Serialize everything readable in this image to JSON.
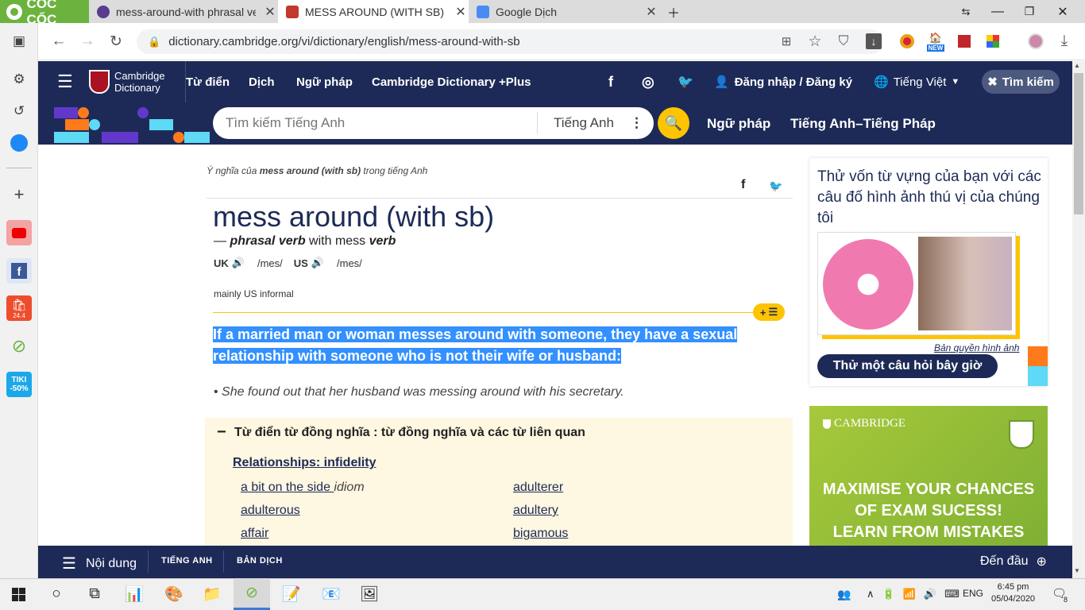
{
  "browser": {
    "name": "CỐC CỐC",
    "tabs": [
      {
        "title": "mess-around-with phrasal ve"
      },
      {
        "title": "MESS AROUND (WITH SB) | Đ"
      },
      {
        "title": "Google Dịch"
      }
    ],
    "url": "dictionary.cambridge.org/vi/dictionary/english/mess-around-with-sb",
    "badge_new": "NEW"
  },
  "sidebar": {
    "tiki_label": "TIKI",
    "tiki_discount": "-50%",
    "shopee_date": "24.4"
  },
  "site": {
    "logo_line1": "Cambridge",
    "logo_line2": "Dictionary",
    "nav": [
      "Từ điển",
      "Dịch",
      "Ngữ pháp",
      "Cambridge Dictionary +Plus"
    ],
    "login": "Đăng nhập / Đăng ký",
    "language": "Tiếng Việt",
    "search_button": "Tìm kiếm",
    "search_placeholder": "Tìm kiếm Tiếng Anh",
    "search_lang": "Tiếng Anh",
    "subnav": [
      "Ngữ pháp",
      "Tiếng Anh–Tiếng Pháp"
    ]
  },
  "entry": {
    "breadcrumb_pre": "Ý nghĩa của ",
    "breadcrumb_word": "mess around (with sb)",
    "breadcrumb_post": " trong tiếng Anh",
    "headword": "mess around (with sb)",
    "pos_dash": "— ",
    "pos": "phrasal verb",
    "pos_with": " with mess ",
    "pos_verb": "verb",
    "uk_label": "UK",
    "us_label": "US",
    "pron_uk": "/mes/",
    "pron_us": "/mes/",
    "usage": "mainly US informal",
    "add_list": "+",
    "definition_line1": "If a married man or woman messes around with someone, they have a sexual",
    "definition_line2": "relationship with someone who is not their wife or husband:",
    "example": "She found out that her husband was messing around with his secretary."
  },
  "related": {
    "toggle": "−",
    "heading": "Từ điển từ đồng nghĩa : từ đồng nghĩa và các từ liên quan",
    "topic": "Relationships: infidelity",
    "left_links": [
      {
        "text": "a bit on the side",
        "note": "idiom"
      },
      {
        "text": "adulterous",
        "note": ""
      },
      {
        "text": "affair",
        "note": ""
      }
    ],
    "right_links": [
      "adulterer",
      "adultery",
      "bigamous"
    ]
  },
  "quiz": {
    "title": "Thử vốn từ vựng của bạn với các câu đố hình ảnh thú vị của chúng tôi",
    "credit": "Bản quyền hình ảnh",
    "button": "Thử một câu hỏi bây giờ"
  },
  "ad": {
    "brand": "CAMBRIDGE",
    "line1": "MAXIMISE YOUR CHANCES",
    "line2": "OF EXAM SUCESS!",
    "line3": "LEARN FROM MISTAKES"
  },
  "bottombar": {
    "contents": "Nội dung",
    "english": "TIẾNG ANH",
    "translation": "BẢN DỊCH",
    "top": "Đến đầu"
  },
  "taskbar": {
    "lang": "ENG",
    "time": "6:45 pm",
    "date": "05/04/2020",
    "notif_count": "8"
  },
  "colors": {
    "navy": "#1d2a57",
    "yellow": "#fec400",
    "highlight": "#3390ff",
    "related_bg": "#fef7e1"
  }
}
